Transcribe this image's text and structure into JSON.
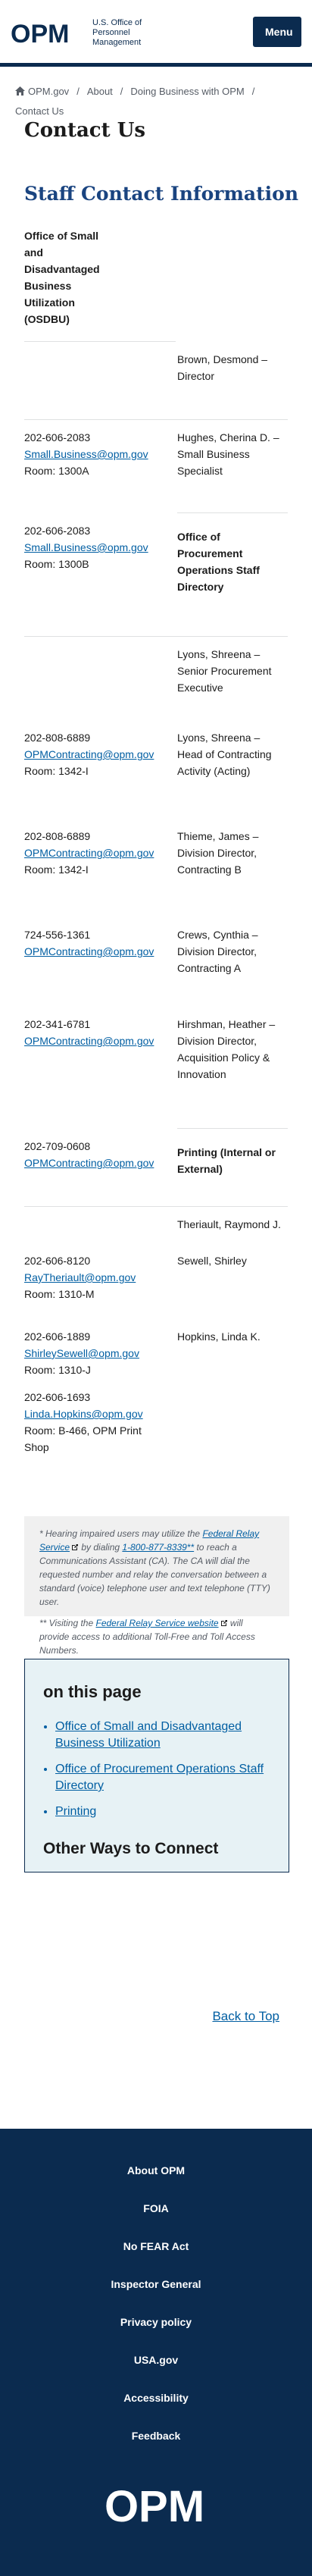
{
  "header": {
    "logo_letters": "OPM",
    "logo_text_line1": "U.S. Office of",
    "logo_text_line2": "Personnel Management",
    "menu_label": "Menu"
  },
  "breadcrumb": {
    "items": [
      "OPM.gov",
      "About",
      "Doing Business with OPM",
      "Contact Us"
    ]
  },
  "page_title": "Contact Us",
  "section_title": "Staff Contact Information",
  "contacts": {
    "osdbu_heading": "Office of Small and Disadvantaged Business Utilization (OSDBU)",
    "brown": "Brown, Desmond – Director",
    "hughes_phone": "202-606-2083",
    "hughes_email": "Small.Business@opm.gov",
    "hughes_room": "Room: 1300A",
    "hughes_name": "Hughes, Cherina D. – Small Business Specialist",
    "osdbu2_phone": "202-606-2083",
    "osdbu2_email": "Small.Business@opm.gov",
    "osdbu2_room": "Room: 1300B",
    "procurement_heading": "Office of Procurement Operations Staff Directory",
    "lyons1": "Lyons, Shreena – Senior Procurement Executive",
    "lyons2_phone": "202-808-6889",
    "lyons2_email": "OPMContracting@opm.gov",
    "lyons2_room": "Room: 1342-I",
    "lyons2_name": "Lyons, Shreena – Head of Contracting Activity (Acting)",
    "thieme_phone": "202-808-6889",
    "thieme_email": "OPMContracting@opm.gov",
    "thieme_room": "Room: 1342-I",
    "thieme_name": "Thieme, James – Division Director, Contracting B",
    "crews_phone": "724-556-1361",
    "crews_email": "OPMContracting@opm.gov",
    "crews_name": "Crews, Cynthia – Division Director, Contracting A",
    "hirshman_phone": "202-341-6781",
    "hirshman_email": "OPMContracting@opm.gov",
    "hirshman_name": "Hirshman, Heather – Division Director, Acquisition Policy & Innovation",
    "printing_phone": "202-709-0608",
    "printing_email": "OPMContracting@opm.gov",
    "printing_heading": "Printing (Internal or External)",
    "theriault_name": "Theriault, Raymond J.",
    "theriault_phone": "202-606-8120",
    "theriault_email": "RayTheriault@opm.gov",
    "theriault_room": "Room: 1310-M",
    "sewell_name": "Sewell, Shirley",
    "sewell_phone": "202-606-1889",
    "sewell_email": "ShirleySewell@opm.gov",
    "sewell_room": "Room: 1310-J",
    "hopkins_name": "Hopkins, Linda K.",
    "hopkins_phone": "202-606-1693",
    "hopkins_email": "Linda.Hopkins@opm.gov",
    "hopkins_room": "Room: B-466, OPM Print Shop"
  },
  "notes": {
    "note1_prefix": "* Hearing impaired users may utilize the ",
    "note1_link": "Federal Relay Service",
    "note1_middle": " by dialing ",
    "note1_number": "1-800-877-8339**",
    "note1_suffix": " to reach a Communications Assistant (CA). The CA will dial the requested number and relay the conversation between a standard (voice) telephone user and text telephone (TTY) user.",
    "note2_prefix": "** Visiting the ",
    "note2_link": "Federal Relay Service website",
    "note2_suffix": " will provide access to additional Toll-Free and Toll Access Numbers."
  },
  "on_this_page": {
    "title": "on this page",
    "links": [
      "Office of Small and Disadvantaged Business Utilization",
      "Office of Procurement Operations Staff Directory",
      "Printing"
    ],
    "other_ways": "Other Ways to Connect"
  },
  "back_to_top": "Back to Top",
  "footer": {
    "links": [
      "About OPM",
      "FOIA",
      "No FEAR Act",
      "Inspector General",
      "Privacy policy",
      "USA.gov",
      "Accessibility",
      "Feedback"
    ],
    "logo_letters": "OPM"
  },
  "colors": {
    "navy": "#0b2b4f",
    "link": "#005ea2",
    "heading_blue": "#1a4480"
  }
}
